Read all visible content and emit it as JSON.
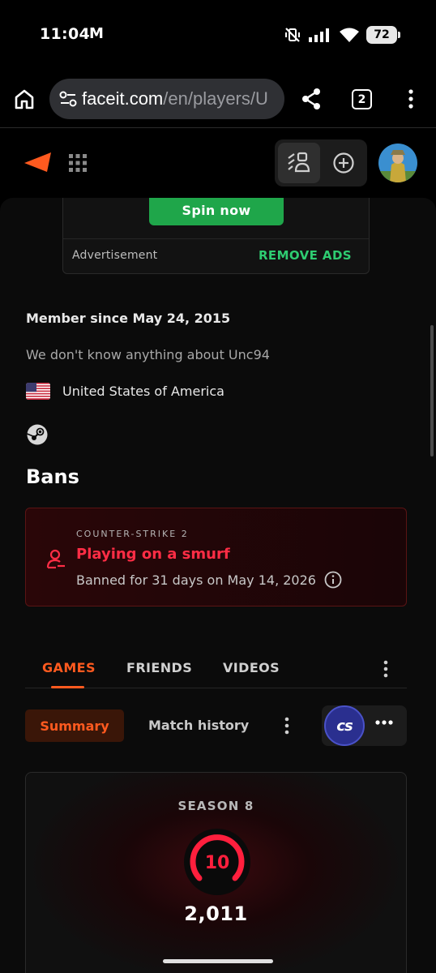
{
  "status_bar": {
    "time": "11:04",
    "mail_icon": "M",
    "battery": "72"
  },
  "browser": {
    "url_host": "faceit.com",
    "url_path": "/en/players/U",
    "tab_count": "2"
  },
  "ad": {
    "cta_label": "Spin now",
    "label": "Advertisement",
    "remove_label": "REMOVE ADS"
  },
  "profile": {
    "member_since": "Member since May 24, 2015",
    "about": "We don't know anything about Unc94",
    "country": "United States of America"
  },
  "bans": {
    "title": "Bans",
    "game": "COUNTER-STRIKE 2",
    "reason": "Playing on a smurf",
    "detail": "Banned for 31 days on May 14, 2026"
  },
  "tabs": [
    {
      "label": "GAMES",
      "active": true
    },
    {
      "label": "FRIENDS",
      "active": false
    },
    {
      "label": "VIDEOS",
      "active": false
    }
  ],
  "subnav": {
    "summary": "Summary",
    "match_history": "Match history",
    "game_badge": "cs"
  },
  "season": {
    "label": "SEASON 8",
    "level": "10",
    "elo": "2,011"
  },
  "colors": {
    "accent": "#ff5a1f",
    "ban_red": "#ff2d45",
    "ad_green": "#2ecc71"
  }
}
